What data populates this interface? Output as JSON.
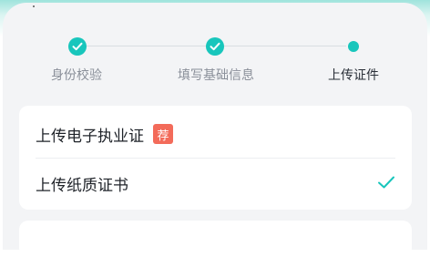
{
  "stepper": {
    "steps": [
      {
        "label": "身份校验",
        "status": "done",
        "icon": "check-icon"
      },
      {
        "label": "填写基础信息",
        "status": "done",
        "icon": "check-icon"
      },
      {
        "label": "上传证件",
        "status": "current",
        "icon": "dot"
      }
    ]
  },
  "options": [
    {
      "label": "上传电子执业证",
      "badge": "荐",
      "selected": false
    },
    {
      "label": "上传纸质证书",
      "selected": true
    }
  ],
  "colors": {
    "accent": "#18c6bc",
    "badge": "#f36b5a",
    "panel_bg": "#f3f4f6"
  }
}
